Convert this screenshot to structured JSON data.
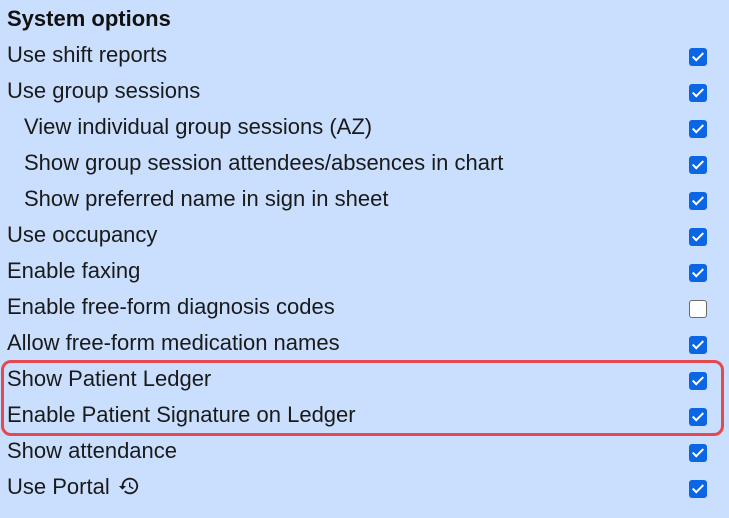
{
  "section": {
    "title": "System options"
  },
  "options": [
    {
      "label": "Use shift reports",
      "checked": true,
      "indent": false
    },
    {
      "label": "Use group sessions",
      "checked": true,
      "indent": false
    },
    {
      "label": "View individual group sessions (AZ)",
      "checked": true,
      "indent": true
    },
    {
      "label": "Show group session attendees/absences in chart",
      "checked": true,
      "indent": true
    },
    {
      "label": "Show preferred name in sign in sheet",
      "checked": true,
      "indent": true
    },
    {
      "label": "Use occupancy",
      "checked": true,
      "indent": false
    },
    {
      "label": "Enable faxing",
      "checked": true,
      "indent": false
    },
    {
      "label": "Enable free-form diagnosis codes",
      "checked": false,
      "indent": false
    },
    {
      "label": "Allow free-form medication names",
      "checked": true,
      "indent": false
    },
    {
      "label": "Show Patient Ledger",
      "checked": true,
      "indent": false
    },
    {
      "label": "Enable Patient Signature on Ledger",
      "checked": true,
      "indent": false
    },
    {
      "label": "Show attendance",
      "checked": true,
      "indent": false
    },
    {
      "label": "Use Portal",
      "checked": true,
      "indent": false,
      "icon": "history-icon"
    }
  ],
  "colors": {
    "background": "#c9dffd",
    "checkbox_checked": "#0a66e4",
    "highlight_border": "#e5494f"
  }
}
